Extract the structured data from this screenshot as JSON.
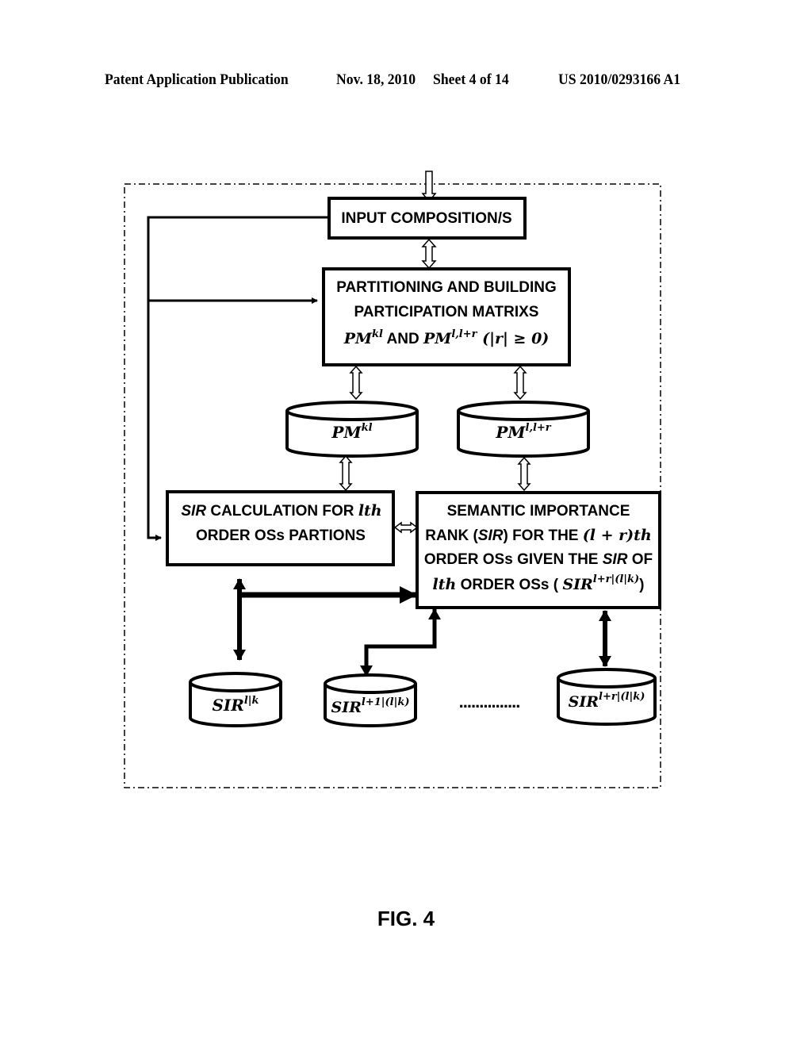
{
  "header": {
    "publication": "Patent Application Publication",
    "date": "Nov. 18, 2010",
    "sheet": "Sheet 4 of 14",
    "number": "US 2010/0293166 A1"
  },
  "boxes": {
    "input": {
      "label": "INPUT COMPOSITION/S"
    },
    "partition": {
      "line1": "PARTITIONING AND BUILDING",
      "line2": "PARTICIPATION MATRIXS",
      "line3_a": "PM",
      "line3_a_sup": "kl",
      "line3_and": " AND ",
      "line3_b": "PM",
      "line3_b_sup": "l,l+r",
      "line3_cond": " (|r| ≥ 0)"
    },
    "sir_calc": {
      "line1_italic": "SIR",
      "line1_rest": " CALCULATION FOR ",
      "line1_math": "lth",
      "line2": "ORDER OSs PARTIONS"
    },
    "semantic": {
      "line1": "SEMANTIC IMPORTANCE",
      "line2_a": "RANK (",
      "line2_italic": "SIR",
      "line2_b": ") FOR THE ",
      "line2_math": "(l + r)th",
      "line3_a": "ORDER OSs GIVEN THE ",
      "line3_italic": "SIR",
      "line3_b": " OF",
      "line4_math": "lth",
      "line4_a": " ORDER OSs ( ",
      "line4_sir": "SIR",
      "line4_sup": "l+r|(l|k)",
      "line4_b": ")"
    }
  },
  "databases": {
    "pm_kl": {
      "base": "PM",
      "sup": "kl"
    },
    "pm_llr": {
      "base": "PM",
      "sup": "l,l+r"
    },
    "sir_lk": {
      "base": "SIR",
      "sup": "l|k"
    },
    "sir_l1": {
      "base": "SIR",
      "sup": "l+1|(l|k)"
    },
    "sir_lr": {
      "base": "SIR",
      "sup": "l+r|(l|k)"
    }
  },
  "ellipsis": "...............",
  "figure_label": "FIG. 4"
}
